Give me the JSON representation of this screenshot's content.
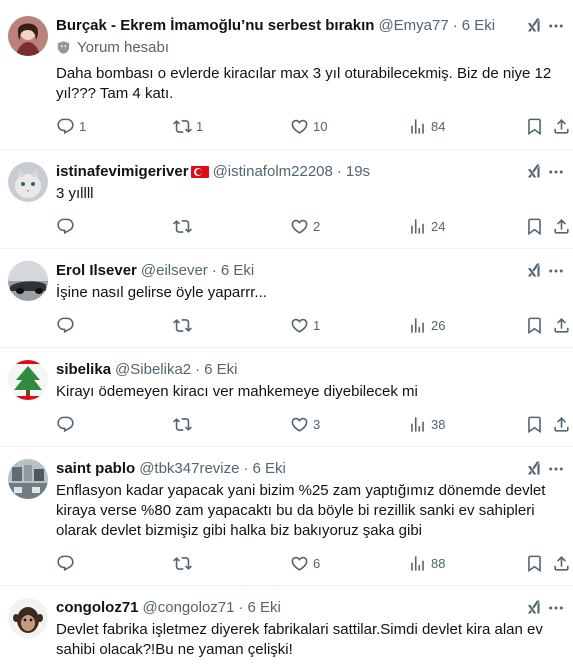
{
  "tweets": [
    {
      "name": "Burçak - Ekrem İmamoğlu’nu serbest bırakın",
      "handle": "@Emya77",
      "time": "6 Eki",
      "badge": "Yorum hesabı",
      "text": "Daha bombası o evlerde kiracılar max 3 yıl oturabilecekmiş. Biz de niye 12 yıl??? Tam 4 katı.",
      "replies": "1",
      "retweets": "1",
      "likes": "10",
      "views": "84"
    },
    {
      "name": "istinafevimigeriver",
      "handle": "@istinafolm22208",
      "time": "19s",
      "text": "3 yıllll",
      "replies": "",
      "retweets": "",
      "likes": "2",
      "views": "24"
    },
    {
      "name": "Erol Ilsever",
      "handle": "@eilsever",
      "time": "6 Eki",
      "text": "İşine nasıl gelirse öyle yaparrr...",
      "replies": "",
      "retweets": "",
      "likes": "1",
      "views": "26"
    },
    {
      "name": "sibelika",
      "handle": "@Sibelika2",
      "time": "6 Eki",
      "text": "Kirayı ödemeyen kiracı ver mahkemeye diyebilecek mi",
      "replies": "",
      "retweets": "",
      "likes": "3",
      "views": "38"
    },
    {
      "name": "saint pablo",
      "handle": "@tbk347revize",
      "time": "6 Eki",
      "text": "Enflasyon kadar yapacak yani bizim %25 zam yaptığımız dönemde devlet kiraya verse %80 zam yapacaktı bu da böyle bi rezillik sanki ev sahipleri olarak devlet bizmişiz gibi halka biz bakıyoruz şaka gibi",
      "replies": "",
      "retweets": "",
      "likes": "6",
      "views": "88"
    },
    {
      "name": "congoloz71",
      "handle": "@congoloz71",
      "time": "6 Eki",
      "text": "Devlet fabrika işletmez diyerek fabrikalari sattilar.Simdi devlet kira alan ev sahibi olacak?!Bu ne yaman çelişki!"
    }
  ],
  "colors": {
    "muted": "#536471",
    "text": "#0f1419",
    "divider": "#eff3f4"
  },
  "icons": [
    "reply-icon",
    "retweet-icon",
    "like-icon",
    "views-icon",
    "bookmark-icon",
    "share-icon",
    "grok-icon",
    "more-icon",
    "flag-turkey-icon",
    "community-icon"
  ]
}
